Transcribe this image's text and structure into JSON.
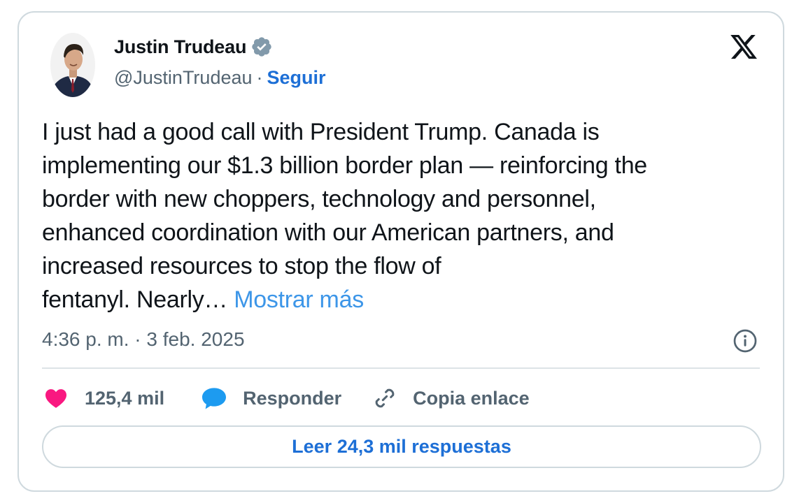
{
  "author": {
    "name": "Justin Trudeau",
    "handle": "@JustinTrudeau",
    "separator": "·",
    "follow_label": "Seguir",
    "verified": true,
    "avatar_icon": "profile-photo"
  },
  "brand_icon": "x-logo-icon",
  "tweet": {
    "lines": [
      "I just had a good call with President Trump. Canada is",
      "implementing our $1.3 billion border plan — reinforcing the",
      "border with new choppers, technology and personnel,",
      "enhanced coordination with our American partners, and",
      "increased resources to stop the flow of",
      "fentanyl. Nearly…"
    ],
    "show_more": "Mostrar más",
    "timestamp": "4:36 p. m. · 3 feb. 2025"
  },
  "actions": {
    "likes": "125,4 mil",
    "reply": "Responder",
    "copy_link": "Copia enlace"
  },
  "read_replies": "Leer 24,3 mil respuestas",
  "colors": {
    "heart": "#f91880",
    "accent_blue": "#1d9bf0",
    "link_blue": "#1d6fd6",
    "text_secondary": "#536471"
  }
}
